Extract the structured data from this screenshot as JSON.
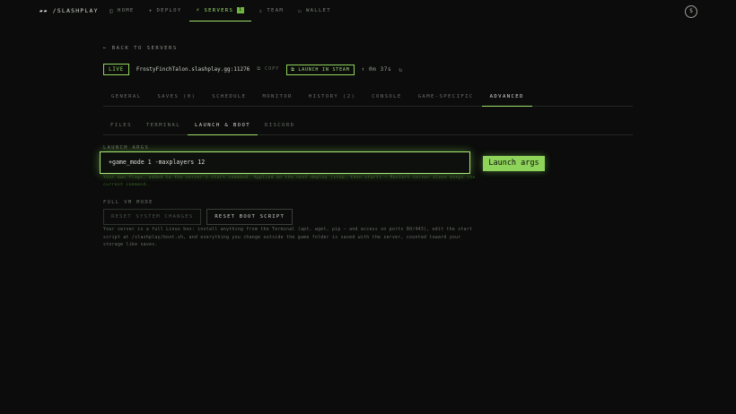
{
  "brand": {
    "logo": "▰▰",
    "name": "/SLASHPLAY"
  },
  "nav": [
    {
      "icon": "◫",
      "icon_name": "home-icon",
      "label": "HOME"
    },
    {
      "icon": "+",
      "icon_name": "deploy-icon",
      "label": "DEPLOY"
    },
    {
      "icon": "⚡",
      "icon_name": "servers-icon",
      "label": "SERVERS",
      "badge": "1"
    },
    {
      "icon": "♙",
      "icon_name": "team-icon",
      "label": "TEAM"
    },
    {
      "icon": "▭",
      "icon_name": "wallet-icon",
      "label": "WALLET"
    }
  ],
  "user": {
    "avatar": "S"
  },
  "back_link": "← BACK TO SERVERS",
  "server": {
    "status": "LIVE",
    "host": "FrostyFinchTalon.slashplay.gg:11276",
    "copy_label": "⧉ COPY",
    "steam_label": "⧉ LAUNCH IN STEAM",
    "uptime": "↑ 0m 37s",
    "refresh_icon": "↻"
  },
  "tabs": [
    "GENERAL",
    "SAVES (0)",
    "SCHEDULE",
    "MONITOR",
    "HISTORY (2)",
    "CONSOLE",
    "GAME-SPECIFIC",
    "ADVANCED"
  ],
  "subtabs": [
    "FILES",
    "TERMINAL",
    "LAUNCH & BOOT",
    "DISCORD"
  ],
  "launch": {
    "label": "LAUNCH ARGS",
    "value": "+game_mode 1 -maxplayers 12",
    "button": "Launch args",
    "hint": "Your own flags, added to the server's start command. Applied on the next deploy (stop, then start) — Restart server alone keeps the current command."
  },
  "fullvm": {
    "label": "FULL VM MODE",
    "reset_system": "RESET SYSTEM CHANGES",
    "reset_boot": "RESET BOOT SCRIPT",
    "desc": "Your server is a full Linux box: install anything from the Terminal (apt, wget, pip — and access on ports 80/443), edit the start script at /slashplay/boot.sh, and everything you change outside the game folder is saved with the server, counted toward your storage like saves."
  },
  "colors": {
    "accent": "#8fd45a",
    "background": "#0b0c0b"
  }
}
